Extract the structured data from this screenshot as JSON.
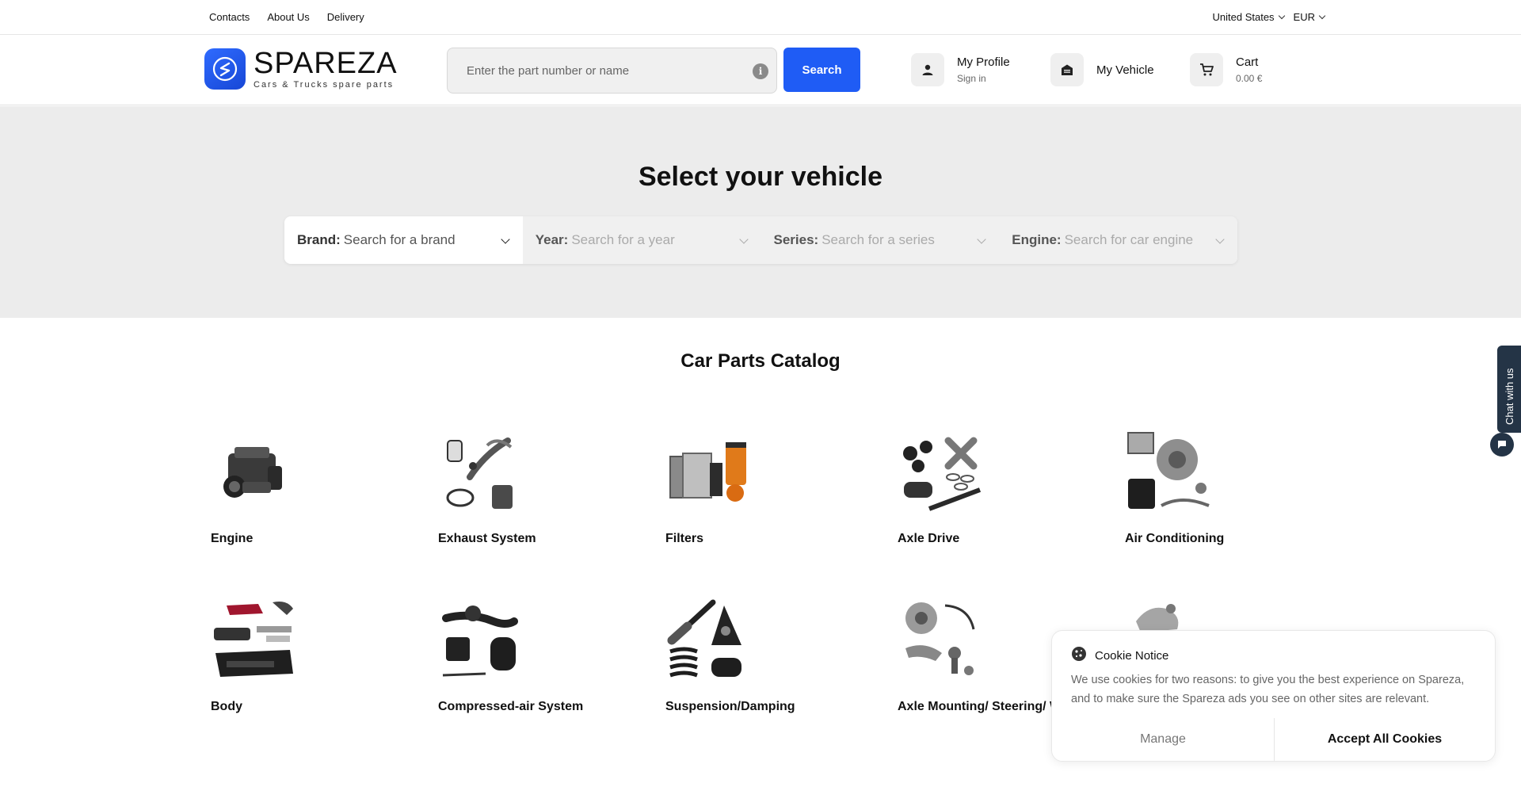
{
  "topbar": {
    "links": [
      "Contacts",
      "About Us",
      "Delivery"
    ],
    "country": "United States",
    "currency": "EUR"
  },
  "header": {
    "logo": {
      "brand": "SPAREZA",
      "tagline": "Cars & Trucks spare parts"
    },
    "search": {
      "placeholder": "Enter the part number or name",
      "button": "Search"
    },
    "profile": {
      "title": "My Profile",
      "subtitle": "Sign in"
    },
    "vehicle": {
      "title": "My Vehicle"
    },
    "cart": {
      "title": "Cart",
      "total": "0.00 €"
    }
  },
  "hero": {
    "title": "Select your vehicle",
    "selectors": [
      {
        "label": "Brand:",
        "placeholder": "Search for a brand"
      },
      {
        "label": "Year:",
        "placeholder": "Search for a year"
      },
      {
        "label": "Series:",
        "placeholder": "Search for a series"
      },
      {
        "label": "Engine:",
        "placeholder": "Search for car engine"
      }
    ]
  },
  "catalog": {
    "title": "Car Parts Catalog",
    "categories": [
      "Engine",
      "Exhaust System",
      "Filters",
      "Axle Drive",
      "Air Conditioning",
      "Body",
      "Compressed-air System",
      "Suspension/Damping",
      "Axle Mounting/ Steering/ Wheels"
    ]
  },
  "chat": {
    "label": "Chat with us"
  },
  "cookie": {
    "title": "Cookie Notice",
    "body": "We use cookies for two reasons: to give you the best experience on Spareza, and to make sure the Spareza ads you see on other sites are relevant.",
    "manage": "Manage",
    "accept": "Accept All Cookies"
  },
  "colors": {
    "accent": "#1f5cf5",
    "hero_bg": "#ececec",
    "chat": "#243446"
  }
}
